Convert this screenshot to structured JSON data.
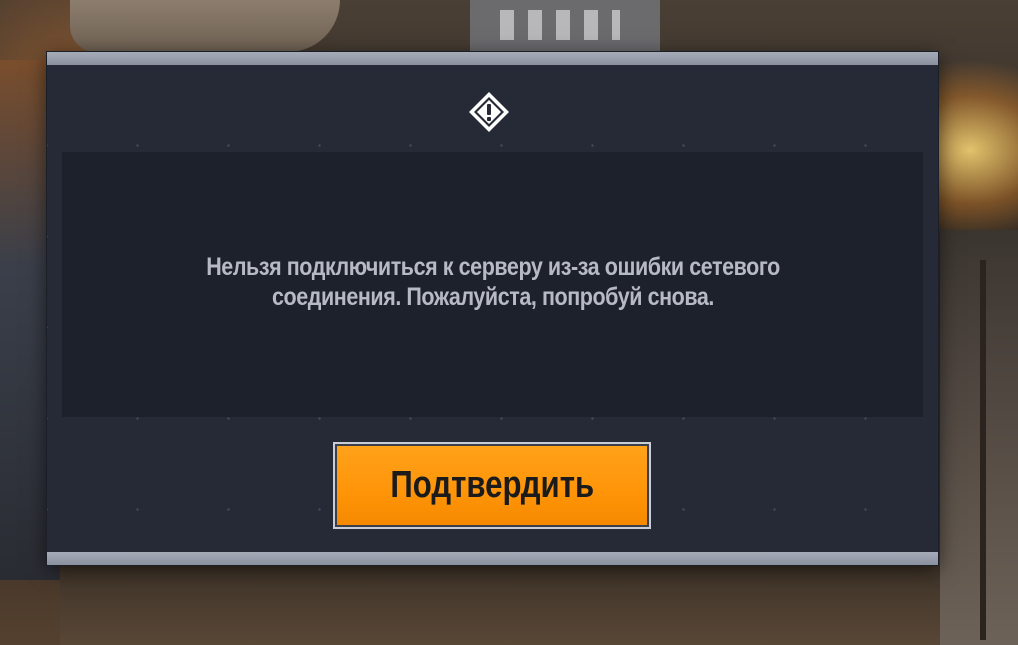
{
  "dialog": {
    "icon": "warning-icon",
    "message": "Нельзя подключиться к серверу из-за ошибки сетевого соединения. Пожалуйста, попробуй снова.",
    "confirm_label": "Подтвердить"
  },
  "colors": {
    "dialog_bg": "#252a36",
    "message_bg": "#1d212b",
    "message_text": "#b7bac4",
    "accent": "#ff9408",
    "frame_bar": "#9aa0ad"
  }
}
